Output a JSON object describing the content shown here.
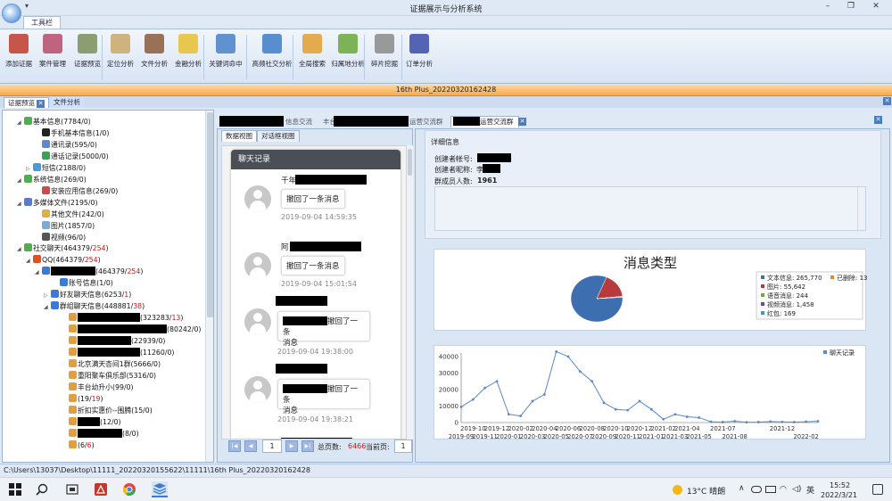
{
  "window": {
    "title": "证据展示与分析系统",
    "min": "–",
    "max": "❐",
    "close": "✕"
  },
  "ribbon": {
    "tab": "工具栏",
    "buttons": [
      {
        "label": "添加证据",
        "color": "#c0392b"
      },
      {
        "label": "案件管理",
        "color": "#b84a6a"
      },
      {
        "label": "证据预览",
        "color": "#7a8f5a"
      },
      {
        "label": "定位分析",
        "color": "#c9a86a"
      },
      {
        "label": "文件分析",
        "color": "#8a5a3a"
      },
      {
        "label": "金融分析",
        "color": "#e8c030"
      },
      {
        "label": "关键词命中",
        "color": "#4a80c8"
      },
      {
        "label": "高频社交分析",
        "color": "#3d7dc8"
      },
      {
        "label": "全局搜索",
        "color": "#e0a030"
      },
      {
        "label": "归属地分析",
        "color": "#6aa83a"
      },
      {
        "label": "碎片挖掘",
        "color": "#8a8a8a"
      },
      {
        "label": "订单分析",
        "color": "#3a4aa8"
      }
    ]
  },
  "case_bar": "16th Plus_20220320162428",
  "doc_tabs": [
    {
      "label": "证据预览"
    },
    {
      "label": "文件分析"
    }
  ],
  "tree": [
    {
      "label": "基本信息(7784/0)",
      "level": 0,
      "exp": "◢",
      "icon": "#4caf50"
    },
    {
      "label": "手机基本信息(1/0)",
      "level": 2,
      "exp": "",
      "icon": "#222"
    },
    {
      "label": "通讯录(595/0)",
      "level": 2,
      "exp": "",
      "icon": "#5a8ad0"
    },
    {
      "label": "通话记录(5000/0)",
      "level": 2,
      "exp": "",
      "icon": "#3aa05a"
    },
    {
      "label": "短信(2188/0)",
      "level": 1,
      "exp": "▷",
      "icon": "#4a9ad8"
    },
    {
      "label": "系统信息(269/0)",
      "level": 0,
      "exp": "◢",
      "icon": "#4caf50"
    },
    {
      "label": "安装应用信息(269/0)",
      "level": 2,
      "exp": "",
      "icon": "#d04a4a"
    },
    {
      "label": "多媒体文件(2195/0)",
      "level": 0,
      "exp": "◢",
      "icon": "#5a7ad0"
    },
    {
      "label": "其他文件(242/0)",
      "level": 2,
      "exp": "",
      "icon": "#e0b040"
    },
    {
      "label": "图片(1857/0)",
      "level": 2,
      "exp": "",
      "icon": "#7aaad8"
    },
    {
      "label": "视频(96/0)",
      "level": 2,
      "exp": "",
      "icon": "#555"
    },
    {
      "label": "社交聊天(464379/",
      "red": "254",
      "tail": ")",
      "level": 0,
      "exp": "◢",
      "icon": "#4caf50"
    },
    {
      "label": "QQ(464379/",
      "red": "254",
      "tail": ")",
      "level": 1,
      "exp": "◢",
      "icon": "#e05020"
    },
    {
      "label": "(464379/",
      "red": "254",
      "tail": ")",
      "level": 2,
      "exp": "◢",
      "icon": "#3a7ad8",
      "blk": 50
    },
    {
      "label": "账号信息(1/0)",
      "level": 4,
      "exp": "",
      "icon": "#3a7ad8"
    },
    {
      "label": "好友聊天信息(6253/",
      "red": "1",
      "tail": ")",
      "level": 3,
      "exp": "▷",
      "icon": "#3a7ad8"
    },
    {
      "label": "群组聊天信息(448881/",
      "red": "38",
      "tail": ")",
      "level": 3,
      "exp": "◢",
      "icon": "#3a7ad8"
    },
    {
      "label": "(323283/",
      "red": "13",
      "tail": ")",
      "level": 5,
      "exp": "",
      "icon": "#e0a040",
      "blk": 70
    },
    {
      "label": "(80242/0)",
      "level": 5,
      "exp": "",
      "icon": "#e0a040",
      "blk": 100
    },
    {
      "label": "(22939/0)",
      "level": 5,
      "exp": "",
      "icon": "#e0a040",
      "blk": 60
    },
    {
      "label": "(11260/0)",
      "level": 5,
      "exp": "",
      "icon": "#e0a040",
      "blk": 70
    },
    {
      "label": "北京满天杏间1群(5666/0)",
      "level": 5,
      "exp": "",
      "icon": "#e0a040"
    },
    {
      "label": "重阳聚车俱乐部(5316/0)",
      "level": 5,
      "exp": "",
      "icon": "#e0a040"
    },
    {
      "label": "丰台幼升小(99/0)",
      "level": 5,
      "exp": "",
      "icon": "#e0a040"
    },
    {
      "label": "(19/",
      "red": "19",
      "tail": ")",
      "level": 5,
      "exp": "",
      "icon": "#e0a040"
    },
    {
      "label": "折扣实惠价--围腾(15/0)",
      "level": 5,
      "exp": "",
      "icon": "#e0a040"
    },
    {
      "label": "(12/0)",
      "level": 5,
      "exp": "",
      "icon": "#e0a040",
      "blk": 25
    },
    {
      "label": "(8/0)",
      "level": 5,
      "exp": "",
      "icon": "#e0a040",
      "blk": 50
    },
    {
      "label": "(6/",
      "red": "6",
      "tail": ")",
      "level": 5,
      "exp": "",
      "icon": "#e0a040"
    }
  ],
  "mid_tabs": {
    "t1": "信息交流",
    "t2": "丰台",
    "t3": "运营交流群",
    "t4": "运营交流群"
  },
  "view_tabs": {
    "data_view": "数据视图",
    "chat_view": "对话框视图"
  },
  "chat": {
    "header": "聊天记录",
    "messages": [
      {
        "name": "千年",
        "text": "撤回了一条消息",
        "time": "2019-09-04 14:59:35"
      },
      {
        "name": "阿",
        "text": "撤回了一条消息",
        "time": "2019-09-04 15:01:54"
      },
      {
        "name": "",
        "text": "撤回了一条",
        "text2": "消息",
        "time": "2019-09-04 19:38:00"
      },
      {
        "name": "",
        "text": "撤回了一条",
        "text2": "消息",
        "time": "2019-09-04 19:38:21"
      }
    ]
  },
  "pager": {
    "first": "|◀",
    "prev": "◀",
    "page": "1",
    "next": "▶",
    "last": "▶|",
    "total_label": "总页数:",
    "total": "6466",
    "cur_label": "当前页:",
    "cur": "1"
  },
  "detail": {
    "title": "详细信息",
    "creator_account_label": "创建者帐号:",
    "creator_name_label": "创建者昵称:",
    "creator_name": "李",
    "member_count_label": "群成员人数:",
    "member_count": "1961"
  },
  "chart_data": [
    {
      "type": "pie",
      "title": "消息类型",
      "slices": [
        {
          "label": "文本信息",
          "value": 265770,
          "color": "#3d6fb0"
        },
        {
          "label": "已删除",
          "value": 13,
          "color": "#e08a2a"
        },
        {
          "label": "图片",
          "value": 55642,
          "color": "#b83a3a"
        },
        {
          "label": "语音消息",
          "value": 244,
          "color": "#7aa83a"
        },
        {
          "label": "视频消息",
          "value": 1458,
          "color": "#6a4a9a"
        },
        {
          "label": "红包",
          "value": 169,
          "color": "#3aa0b0"
        }
      ],
      "legend": [
        "文本信息: 265,770",
        "已删除: 13",
        "图片: 55,642",
        "语音消息: 244",
        "视频消息: 1,458",
        "红包: 169"
      ],
      "legend_position": "right"
    },
    {
      "type": "line",
      "legend": "聊天记录",
      "legend_position": "top-right",
      "ylim": [
        0,
        40000
      ],
      "yticks": [
        "0",
        "10000",
        "20000",
        "30000",
        "40000"
      ],
      "x": [
        "2019-09",
        "2019-10",
        "2019-11",
        "2019-12",
        "2020-01",
        "2020-02",
        "2020-03",
        "2020-04",
        "2020-05",
        "2020-06",
        "2020-07",
        "2020-08",
        "2020-09",
        "2020-10",
        "2020-11",
        "2020-12",
        "2021-01",
        "2021-02",
        "2021-03",
        "2021-04",
        "2021-05",
        "2021-06",
        "2021-07",
        "2021-08",
        "2021-09",
        "2021-10",
        "2021-11",
        "2021-12",
        "2022-01",
        "2022-02",
        "2022-03"
      ],
      "x_top_labels": [
        "2019-10",
        "2019-12",
        "2020-02",
        "2020-04",
        "2020-06",
        "2020-08",
        "2020-10",
        "2020-12",
        "2021-02",
        "2021-04",
        "2021-07",
        "2021-12"
      ],
      "x_bottom_labels": [
        "2019-09",
        "2019-11",
        "2020-01",
        "2020-03",
        "2020-05",
        "2020-07",
        "2020-09",
        "2020-11",
        "2021-01",
        "2021-03",
        "2021-05",
        "2021-08",
        "2022-02"
      ],
      "values": [
        9500,
        14000,
        21000,
        25000,
        5000,
        4000,
        13000,
        17000,
        43000,
        40000,
        31000,
        25000,
        12000,
        8000,
        7500,
        13000,
        8000,
        2000,
        5000,
        3500,
        3000,
        500,
        300,
        800,
        200,
        300,
        600,
        400,
        300,
        500,
        800
      ],
      "color": "#5a8ac8"
    }
  ],
  "status": {
    "path": "C:\\Users\\13037\\Desktop\\11111_20220320155622\\11111\\16th Plus_20220320162428"
  },
  "taskbar": {
    "weather": "13°C  晴朗",
    "ime": "英",
    "time": "15:52",
    "date": "2022/3/21"
  }
}
